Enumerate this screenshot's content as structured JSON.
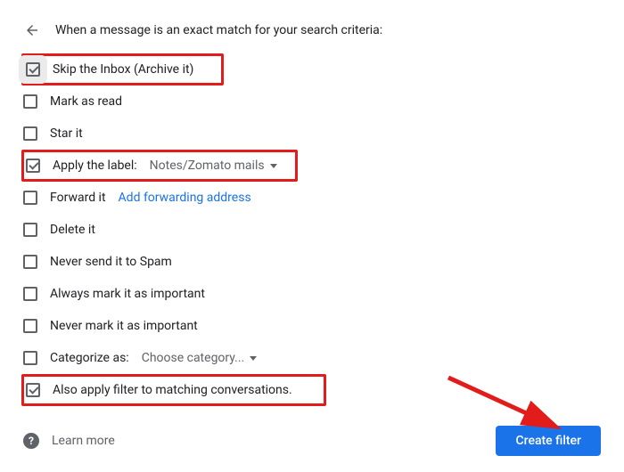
{
  "header": {
    "title": "When a message is an exact match for your search criteria:"
  },
  "options": {
    "skip_inbox": "Skip the Inbox (Archive it)",
    "mark_read": "Mark as read",
    "star": "Star it",
    "apply_label_prefix": "Apply the label:",
    "apply_label_value": "Notes/Zomato mails",
    "forward": "Forward it",
    "add_forward": "Add forwarding address",
    "delete": "Delete it",
    "never_spam": "Never send it to Spam",
    "always_important": "Always mark it as important",
    "never_important": "Never mark it as important",
    "categorize_prefix": "Categorize as:",
    "categorize_value": "Choose category...",
    "also_apply": "Also apply filter to matching conversations."
  },
  "footer": {
    "learn": "Learn more",
    "create": "Create filter",
    "help_glyph": "?"
  }
}
